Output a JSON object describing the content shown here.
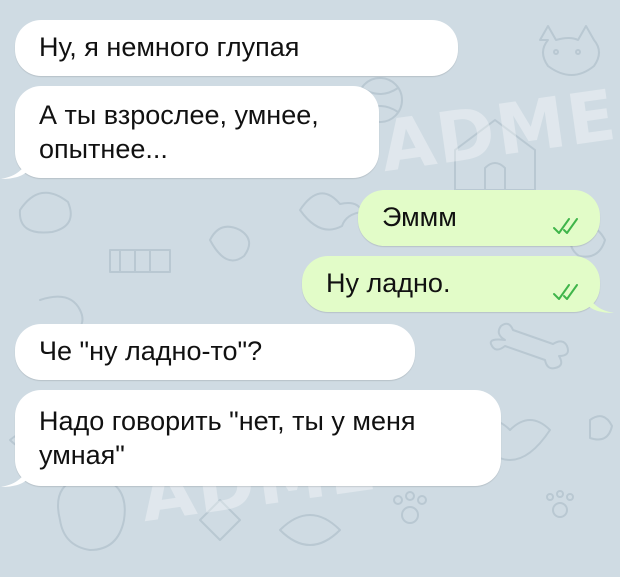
{
  "chat": {
    "messages": [
      {
        "direction": "incoming",
        "text": "Ну, я немного глупая"
      },
      {
        "direction": "incoming",
        "text": "А ты взрослее, умнее,\nопытнее..."
      },
      {
        "direction": "outgoing",
        "text": "Эммм",
        "status_icon": "double-check-icon"
      },
      {
        "direction": "outgoing",
        "text": "Ну ладно.",
        "status_icon": "double-check-icon"
      },
      {
        "direction": "incoming",
        "text": "Че \"ну ладно-то\"?"
      },
      {
        "direction": "incoming",
        "text": "Надо говорить \"нет, ты у меня\nумная\""
      }
    ]
  },
  "colors": {
    "background": "#cfdbe3",
    "incoming_bubble": "#ffffff",
    "outgoing_bubble": "#e2fcc8",
    "read_ticks": "#3fb54a"
  }
}
